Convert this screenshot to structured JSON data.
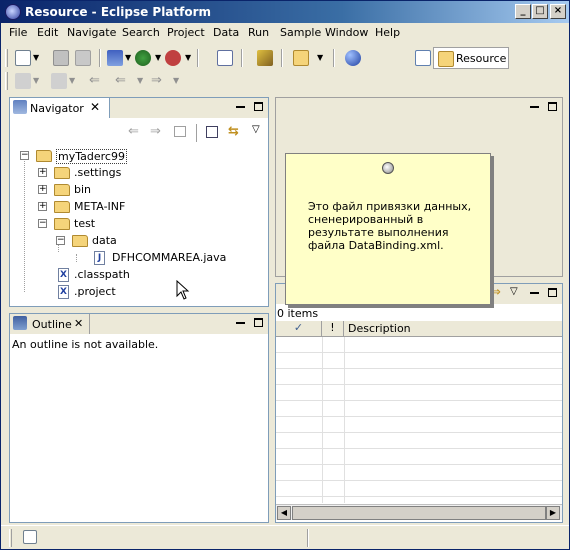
{
  "window": {
    "title": "Resource - Eclipse Platform"
  },
  "menu": [
    "File",
    "Edit",
    "Navigate",
    "Search",
    "Project",
    "Data",
    "Run",
    "Sample",
    "Window",
    "Help"
  ],
  "perspective": {
    "label": "Resource"
  },
  "navigator": {
    "tab_label": "Navigator",
    "tree": [
      {
        "label": "myTaderc99",
        "level": 0,
        "kind": "project",
        "expanded": true
      },
      {
        "label": ".settings",
        "level": 1,
        "kind": "folder",
        "expanded": false
      },
      {
        "label": "bin",
        "level": 1,
        "kind": "folder",
        "expanded": false
      },
      {
        "label": "META-INF",
        "level": 1,
        "kind": "folder",
        "expanded": false
      },
      {
        "label": "test",
        "level": 1,
        "kind": "folder",
        "expanded": true
      },
      {
        "label": "data",
        "level": 2,
        "kind": "folder",
        "expanded": true
      },
      {
        "label": "DFHCOMMAREA.java",
        "level": 3,
        "kind": "java"
      },
      {
        "label": ".classpath",
        "level": 1,
        "kind": "xml"
      },
      {
        "label": ".project",
        "level": 1,
        "kind": "xml"
      }
    ]
  },
  "outline": {
    "tab_label": "Outline",
    "message": "An outline is not available."
  },
  "tasks": {
    "count_text": "0 items",
    "columns": [
      "",
      "!",
      "Description"
    ]
  },
  "note": {
    "text": "Это файл привязки данных, сненерированный в результате выполнения файла DataBinding.xml."
  },
  "colors": {
    "titlebar": "#0a246a",
    "note_bg": "#ffffc8",
    "chrome": "#ece9d8"
  }
}
